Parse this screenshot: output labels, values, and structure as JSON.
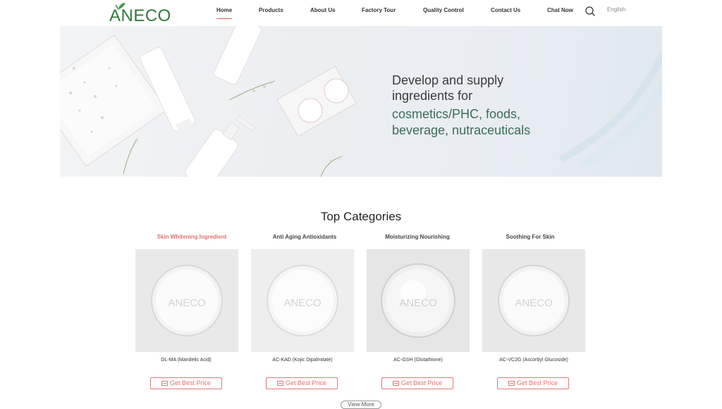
{
  "logo": {
    "text": "ANECO"
  },
  "nav": [
    {
      "label": "Home",
      "active": true
    },
    {
      "label": "Products"
    },
    {
      "label": "About Us"
    },
    {
      "label": "Factory Tour"
    },
    {
      "label": "Quality Control"
    },
    {
      "label": "Contact Us"
    },
    {
      "label": "Chat Now"
    }
  ],
  "search_icon": "search-icon",
  "language": "English",
  "banner": {
    "line1": "Develop and supply",
    "line2": "ingredients for",
    "line3": "cosmetics/PHC, foods,",
    "line4": "beverage, nutraceuticals"
  },
  "section_title": "Top Categories",
  "categories": [
    {
      "label": "Skin Whitening Ingredient",
      "product": "DL-MA (Mandelic Acid)",
      "button": "Get Best Price",
      "watermark": "ANECO"
    },
    {
      "label": "Anti Aging Antioxidants",
      "product": "AC-KAD (Kojic Dipalmitate)",
      "button": "Get Best Price",
      "watermark": "ANECO"
    },
    {
      "label": "Moisturizing Nourishing",
      "product": "AC-GSH (Glutathione)",
      "button": "Get Best Price",
      "watermark": "ANECO"
    },
    {
      "label": "Soothing For Skin",
      "product": "AC-VC2G (Ascorbyl Glucoside)",
      "button": "Get Best Price",
      "watermark": "ANECO"
    }
  ],
  "view_more": "View More",
  "colors": {
    "accent": "#e07070",
    "brand_green": "#2f7a3c",
    "banner_text_green": "#3b6d57"
  }
}
